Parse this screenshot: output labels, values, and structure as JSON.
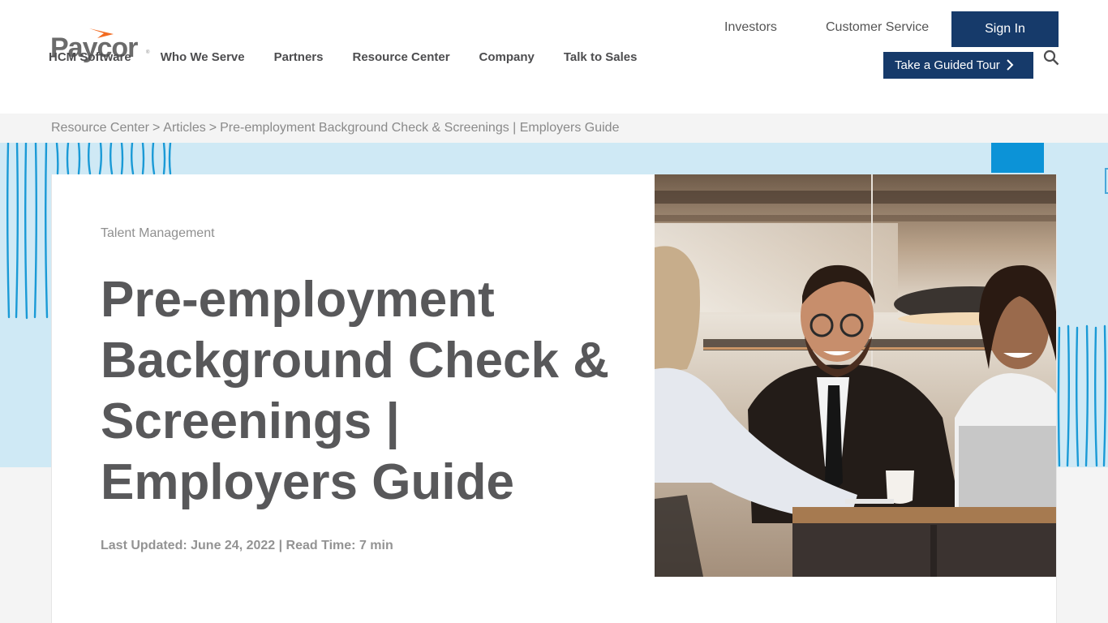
{
  "brand": {
    "name": "Paycor",
    "registered": "®",
    "colors": {
      "navy": "#163a6a",
      "accent_orange": "#f26b21",
      "light_blue": "#cfe9f5",
      "bright_blue": "#0c93d7",
      "text_gray": "#58585a"
    }
  },
  "nav": {
    "items": [
      {
        "label": "HCM Software"
      },
      {
        "label": "Who We Serve"
      },
      {
        "label": "Partners"
      },
      {
        "label": "Resource Center"
      },
      {
        "label": "Company"
      },
      {
        "label": "Talk to Sales"
      }
    ]
  },
  "utility": {
    "investors": "Investors",
    "customer_service": "Customer Service",
    "sign_in": "Sign In",
    "guided_tour": "Take a Guided Tour",
    "search_icon": "search-icon",
    "tour_icon": "chevron-right-icon"
  },
  "breadcrumb": {
    "items": [
      {
        "label": "Resource Center"
      },
      {
        "label": "Articles"
      },
      {
        "label": "Pre-employment Background Check & Screenings | Employers Guide"
      }
    ],
    "separator": ">"
  },
  "article": {
    "category": "Talent Management",
    "title": "Pre-employment Background Check & Screenings | Employers Guide",
    "meta": "Last Updated: June 24, 2022 | Read Time: 7 min",
    "image_alt": "Job interview with smiling candidate in office"
  }
}
